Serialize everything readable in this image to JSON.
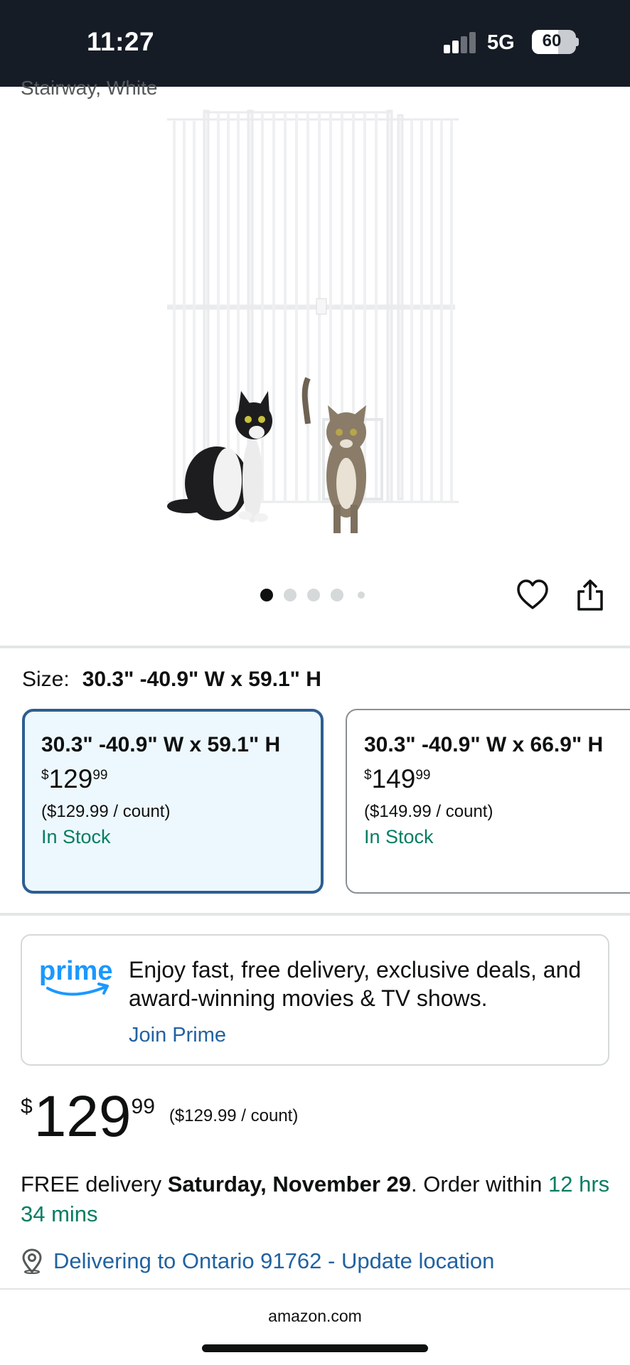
{
  "status_bar": {
    "time": "11:27",
    "network": "5G",
    "battery": "60"
  },
  "product": {
    "title_fragment": "Stairway, White",
    "image_description_icon": "pet-gate-with-cats-image",
    "carousel": {
      "total": 5,
      "active": 1
    }
  },
  "actions": {
    "wishlist_icon": "heart-icon",
    "share_icon": "share-icon"
  },
  "size": {
    "label": "Size:",
    "selected_value": "30.3\" -40.9\" W x 59.1\" H",
    "options": [
      {
        "name": "30.3\" -40.9\" W x 59.1\" H",
        "price_symbol": "$",
        "price_whole": "129",
        "price_fraction": "99",
        "unit_price": "($129.99 / count)",
        "stock": "In Stock",
        "selected": true
      },
      {
        "name": "30.3\" -40.9\" W x 66.9\" H",
        "price_symbol": "$",
        "price_whole": "149",
        "price_fraction": "99",
        "unit_price": "($149.99 / count)",
        "stock": "In Stock",
        "selected": false
      }
    ]
  },
  "prime": {
    "logo_text": "prime",
    "message": "Enjoy fast, free delivery, exclusive deals, and award-winning movies & TV shows.",
    "link": "Join Prime"
  },
  "buybox": {
    "price_symbol": "$",
    "price_whole": "129",
    "price_fraction": "99",
    "unit_price": "($129.99 / count)",
    "delivery_prefix": "FREE delivery ",
    "delivery_date": "Saturday, November 29",
    "delivery_mid": ". Order within ",
    "delivery_cutoff": "12 hrs 34 mins",
    "location": "Delivering to Ontario 91762 - Update location"
  },
  "browser": {
    "url": "amazon.com"
  },
  "colors": {
    "status_bar_bg": "#161c26",
    "link": "#2162a1",
    "in_stock": "#067d62",
    "selected_border": "#2c5e91",
    "selected_bg": "#edf8fe",
    "prime_blue": "#1a98ff"
  }
}
